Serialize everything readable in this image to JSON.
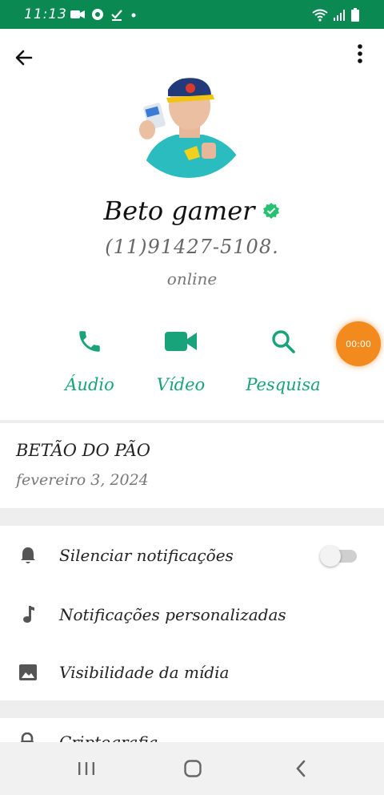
{
  "status_bar": {
    "time": "11:13",
    "icons": [
      "video-call-icon",
      "chrome-icon",
      "download-done-icon",
      "dot-icon",
      "wifi-icon",
      "signal-icon",
      "battery-icon"
    ]
  },
  "header": {
    "back_icon": "arrow-left-icon",
    "menu_icon": "more-vert-icon"
  },
  "profile": {
    "name": "Beto gamer",
    "verified_icon": "verified-badge-icon",
    "phone": "(11)91427-5108.",
    "status": "online"
  },
  "actions": [
    {
      "label": "Áudio",
      "icon": "phone-icon"
    },
    {
      "label": "Vídeo",
      "icon": "videocam-icon"
    },
    {
      "label": "Pesquisa",
      "icon": "search-icon"
    }
  ],
  "timer": {
    "text": "00:00"
  },
  "about": {
    "title": "BETÃO DO PÃO",
    "date": "fevereiro 3, 2024"
  },
  "settings": {
    "mute": {
      "label": "Silenciar notificações",
      "icon": "bell-icon",
      "enabled": false
    },
    "custom_notifications": {
      "label": "Notificações personalizadas",
      "icon": "music-note-icon"
    },
    "media_visibility": {
      "label": "Visibilidade da mídia",
      "icon": "image-icon"
    },
    "partial_next": {
      "label": "Criptografia",
      "icon": "lock-icon"
    }
  },
  "colors": {
    "accent_green": "#19a37a",
    "status_bar": "#0a8a52",
    "timer_orange": "#f28a1d"
  }
}
